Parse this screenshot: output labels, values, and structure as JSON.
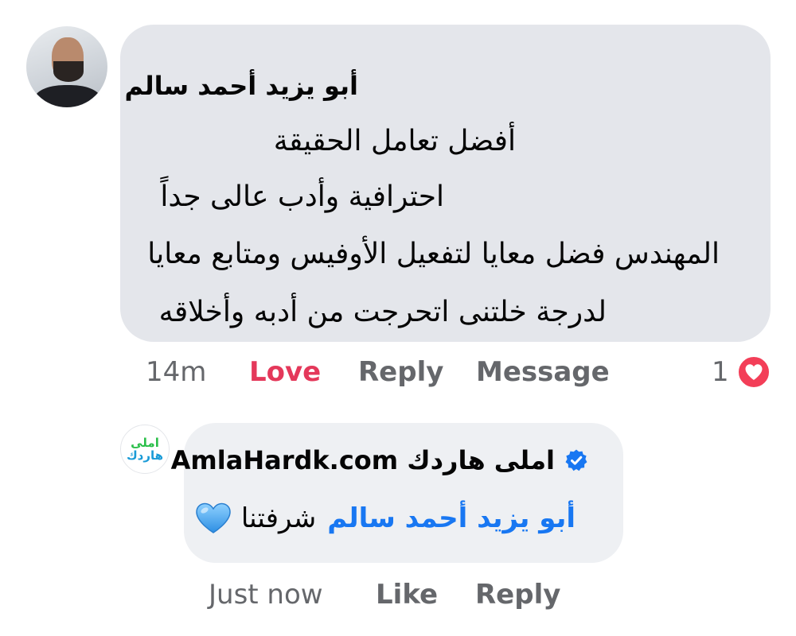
{
  "comment": {
    "author": "أبو يزيد أحمد سالم",
    "lines": [
      "أفضل تعامل الحقيقة",
      "احترافية وأدب عالى جداً",
      "المهندس فضل معايا لتفعيل الأوفيس ومتابع معايا",
      "لدرجة خلتنى اتحرجت من أدبه وأخلاقه"
    ],
    "actions": {
      "time": "14m",
      "love": "Love",
      "reply": "Reply",
      "message": "Message"
    },
    "reaction_count": "1",
    "reaction_icon": "heart-icon",
    "colors": {
      "love": "#e4385a",
      "heart_badge": "#f33e58",
      "bubble": "#e4e6eb"
    }
  },
  "reply": {
    "author": "املى هاردك AmlaHardk.com",
    "verified_icon": "verified-badge-icon",
    "mention": "أبو يزيد أحمد سالم",
    "text": "شرفتنا",
    "emoji": "blue-heart-emoji",
    "actions": {
      "time": "Just now",
      "like": "Like",
      "reply": "Reply"
    },
    "logo": {
      "top": "املى",
      "bottom": "هاردك"
    },
    "colors": {
      "mention": "#1877f2",
      "verified": "#1877f2",
      "logo_green": "#2bbf4a",
      "logo_blue": "#1a9bd7"
    }
  }
}
